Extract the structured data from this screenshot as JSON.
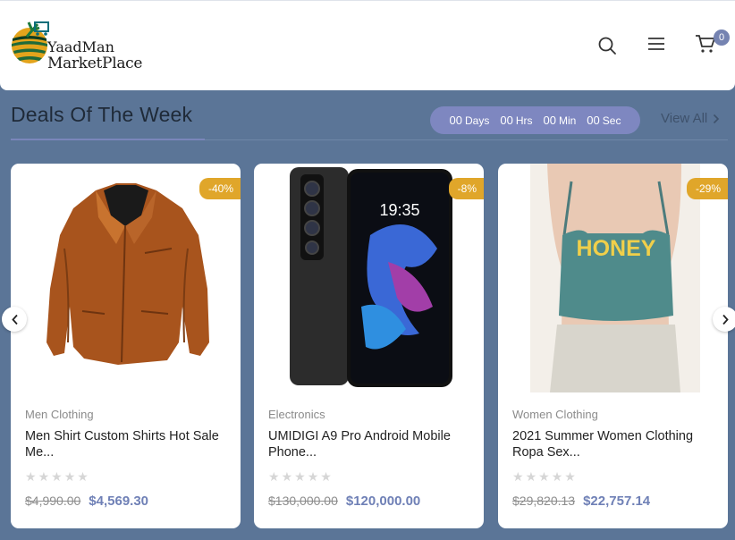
{
  "brand": {
    "line1": "YaadMan",
    "line2": "MarketPlace"
  },
  "header": {
    "search_icon": "search-icon",
    "menu_icon": "hamburger-menu-icon",
    "cart_icon": "cart-icon",
    "cart_count": "0"
  },
  "deals": {
    "title": "Deals Of The Week",
    "countdown": [
      {
        "value": "00",
        "label": "Days"
      },
      {
        "value": "00",
        "label": "Hrs"
      },
      {
        "value": "00",
        "label": "Min"
      },
      {
        "value": "00",
        "label": "Sec"
      }
    ],
    "view_all": "View All",
    "products": [
      {
        "discount": "-40%",
        "category": "Men Clothing",
        "name": "Men Shirt Custom Shirts Hot Sale Me...",
        "rating": 0,
        "old_price": "$4,990.00",
        "price": "$4,569.30"
      },
      {
        "discount": "-8%",
        "category": "Electronics",
        "name": "UMIDIGI A9 Pro Android Mobile Phone...",
        "rating": 0,
        "old_price": "$130,000.00",
        "price": "$120,000.00"
      },
      {
        "discount": "-29%",
        "category": "Women Clothing",
        "name": "2021 Summer Women Clothing Ropa Sex...",
        "rating": 0,
        "old_price": "$29,820.13",
        "price": "$22,757.14"
      }
    ]
  },
  "phone_screen": {
    "time": "19:35"
  },
  "top_text": {
    "print": "HONEY"
  },
  "colors": {
    "background": "#5b7597",
    "accent": "#7583b1",
    "discount_badge": "#e0a62a"
  }
}
